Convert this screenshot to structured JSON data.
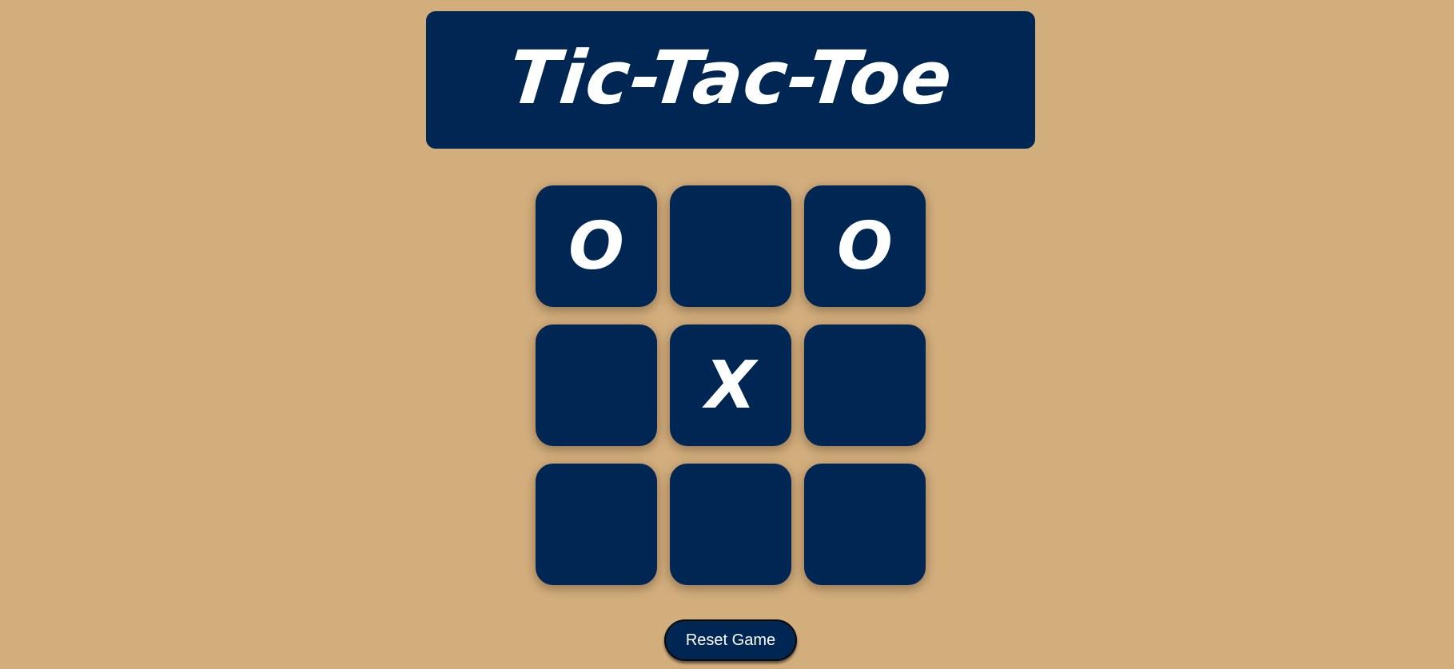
{
  "title": "Tic-Tac-Toe",
  "board": {
    "cells": [
      "O",
      "",
      "O",
      "",
      "X",
      "",
      "",
      "",
      ""
    ]
  },
  "reset_label": "Reset Game",
  "colors": {
    "background": "#d3ae7d",
    "tile": "#002654",
    "text": "#ffffff"
  }
}
